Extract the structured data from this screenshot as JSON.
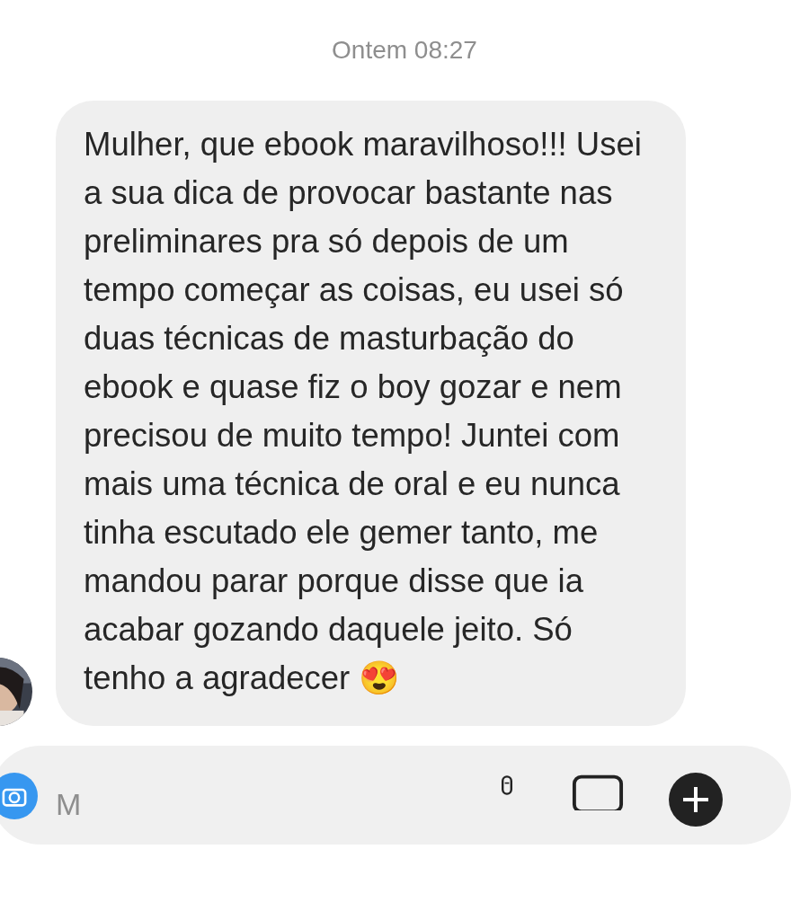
{
  "timestamp": "Ontem 08:27",
  "message": {
    "text": "Mulher, que ebook maravilhoso!!! Usei a sua dica de provocar bastante nas preliminares pra só depois de um tempo começar as coisas, eu usei só duas técnicas de masturbação do ebook e quase fiz o boy gozar e nem precisou de muito tempo! Juntei com mais uma técnica de oral e eu nunca tinha escutado ele gemer tanto, me mandou parar porque disse que ia acabar gozando daquele jeito. Só tenho a agradecer 😍"
  },
  "composer": {
    "placeholder": "M"
  }
}
